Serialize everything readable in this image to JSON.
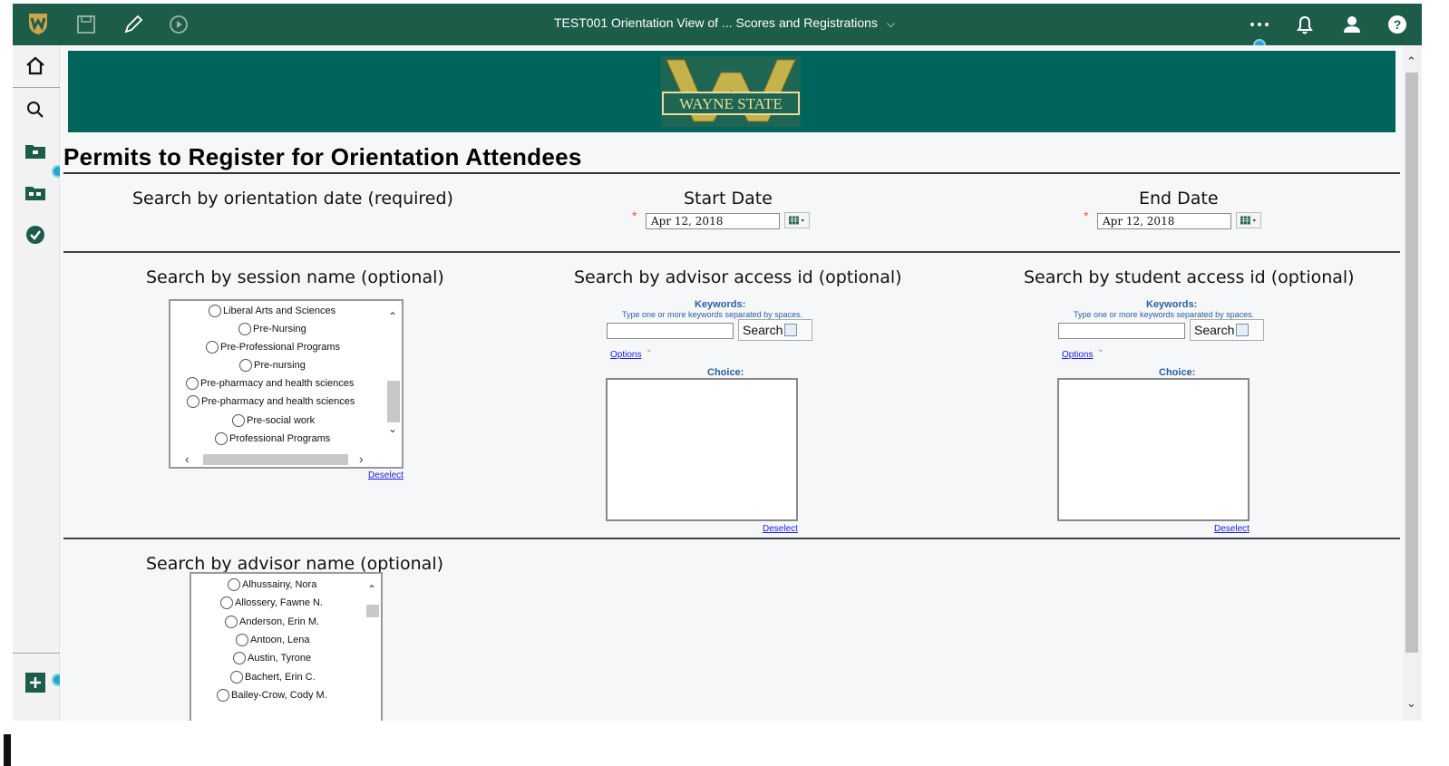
{
  "topbar": {
    "title": "TEST001 Orientation View of ... Scores and Registrations",
    "icons": [
      "wsu-logo-icon",
      "save-icon",
      "edit-pencil-icon",
      "play-icon",
      "more-icon",
      "notification-bell-icon",
      "user-icon",
      "help-icon"
    ]
  },
  "leftnav": {
    "icons": [
      "home-icon",
      "search-icon",
      "my-content-icon",
      "team-content-icon",
      "recent-check-icon",
      "new-plus-icon"
    ]
  },
  "banner": {
    "logo_text": "WAYNE STATE"
  },
  "page": {
    "title": "Permits to Register for Orientation Attendees",
    "date_section": {
      "label": "Search by orientation date (required)",
      "start_label": "Start Date",
      "start_value": "Apr 12, 2018",
      "end_label": "End Date",
      "end_value": "Apr 12, 2018"
    },
    "session": {
      "label": "Search by session name (optional)",
      "options": [
        "Liberal Arts and Sciences",
        "Pre-Nursing",
        "Pre-Professional Programs",
        "Pre-nursing",
        "Pre-pharmacy and health sciences",
        "Pre-pharmacy and health sciences",
        "Pre-social work",
        "Professional Programs"
      ],
      "deselect": "Deselect"
    },
    "advisor_access": {
      "label": "Search by advisor access id (optional)",
      "keywords": "Keywords:",
      "keywords_hint": "Type one or more keywords separated by spaces.",
      "search_btn": "Search",
      "options": "Options",
      "choice": "Choice:",
      "deselect": "Deselect"
    },
    "student_access": {
      "label": "Search by student access id (optional)",
      "keywords": "Keywords:",
      "keywords_hint": "Type one or more keywords separated by spaces.",
      "search_btn": "Search",
      "options": "Options",
      "choice": "Choice:",
      "deselect": "Deselect"
    },
    "advisor_name": {
      "label": "Search by advisor name (optional)",
      "options": [
        "Alhussainy, Nora",
        "Allossery, Fawne N.",
        "Anderson, Erin M.",
        "Antoon, Lena",
        "Austin, Tyrone",
        "Bachert, Erin C.",
        "Bailey-Crow, Cody M."
      ]
    }
  },
  "colors": {
    "topbar": "#1e5c4a",
    "banner": "#00645a",
    "link": "#1a1aee",
    "required": "#e06020"
  }
}
